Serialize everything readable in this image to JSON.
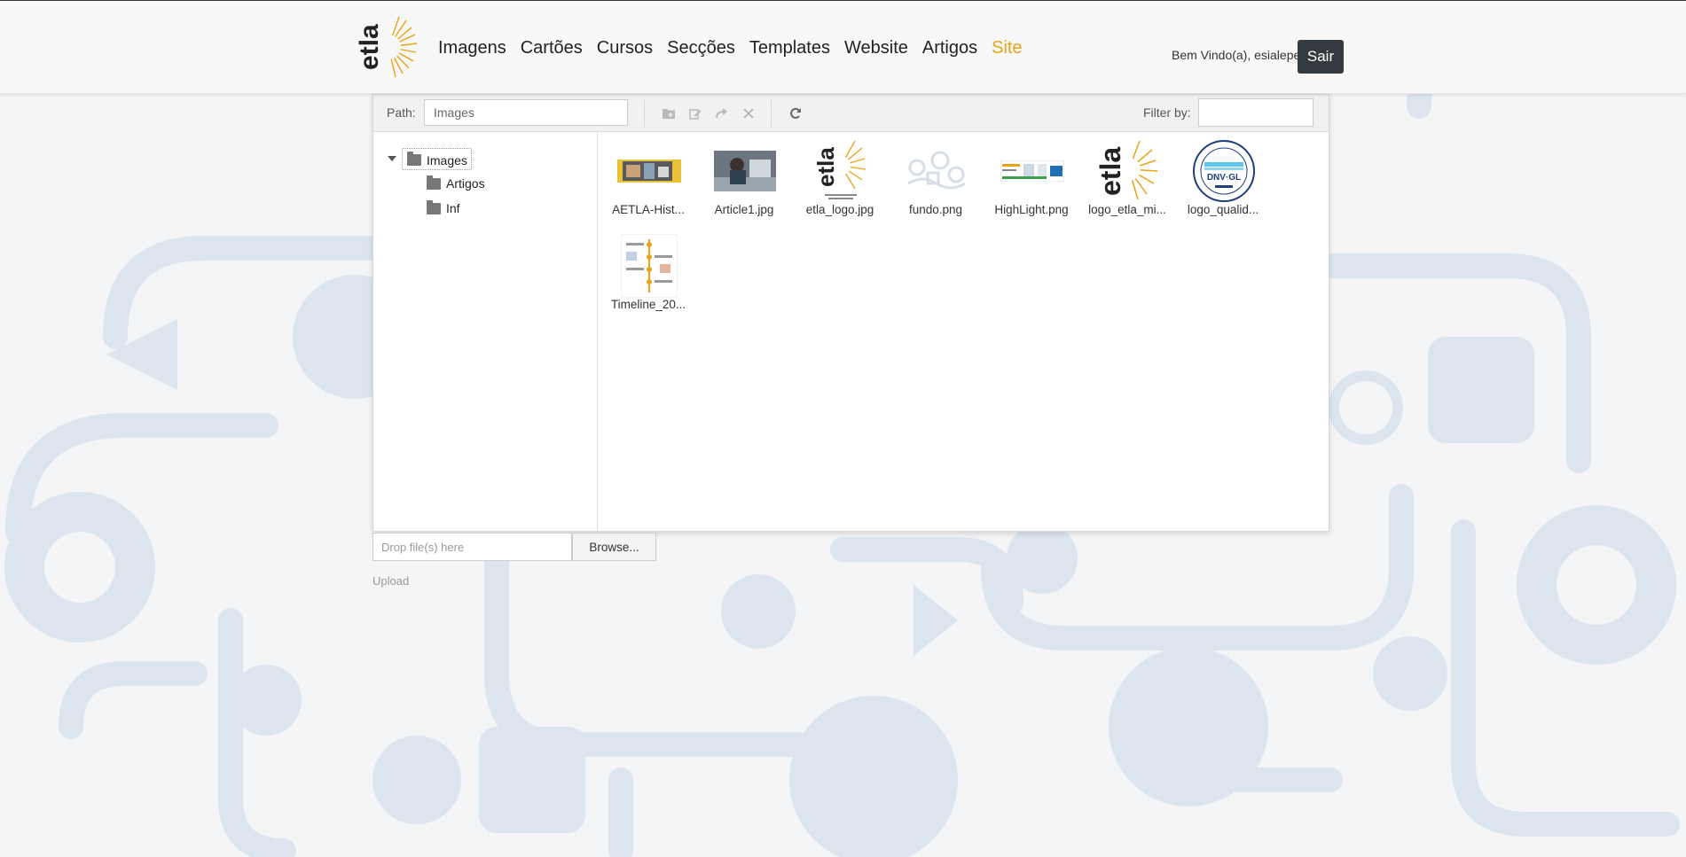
{
  "header": {
    "nav": [
      "Imagens",
      "Cartões",
      "Cursos",
      "Secções",
      "Templates",
      "Website",
      "Artigos",
      "Site"
    ],
    "active_nav": "Site",
    "welcome": "Bem Vindo(a), esialepe",
    "logout_label": "Sair",
    "logo_text": "etla"
  },
  "toolbar": {
    "path_label": "Path:",
    "path_value": "Images",
    "filter_label": "Filter by:",
    "filter_value": "",
    "buttons": [
      "new-folder",
      "rename",
      "redo",
      "delete",
      "refresh"
    ]
  },
  "tree": {
    "root": "Images",
    "children": [
      "Artigos",
      "Inf"
    ]
  },
  "files": [
    {
      "name": "AETLA-Hist...",
      "thumb": "banner-photo"
    },
    {
      "name": "Article1.jpg",
      "thumb": "photo"
    },
    {
      "name": "etla_logo.jpg",
      "thumb": "etla-logo"
    },
    {
      "name": "fundo.png",
      "thumb": "pattern"
    },
    {
      "name": "HighLight.png",
      "thumb": "banner-small"
    },
    {
      "name": "logo_etla_mi...",
      "thumb": "etla-logo"
    },
    {
      "name": "logo_qualid...",
      "thumb": "dnv-badge"
    },
    {
      "name": "Timeline_20...",
      "thumb": "timeline-doc"
    }
  ],
  "upload": {
    "drop_placeholder": "Drop file(s) here",
    "browse_label": "Browse...",
    "upload_label": "Upload"
  },
  "colors": {
    "accent": "#e8a317",
    "logout_bg": "#343a40",
    "pattern": "#d8e2ec"
  }
}
